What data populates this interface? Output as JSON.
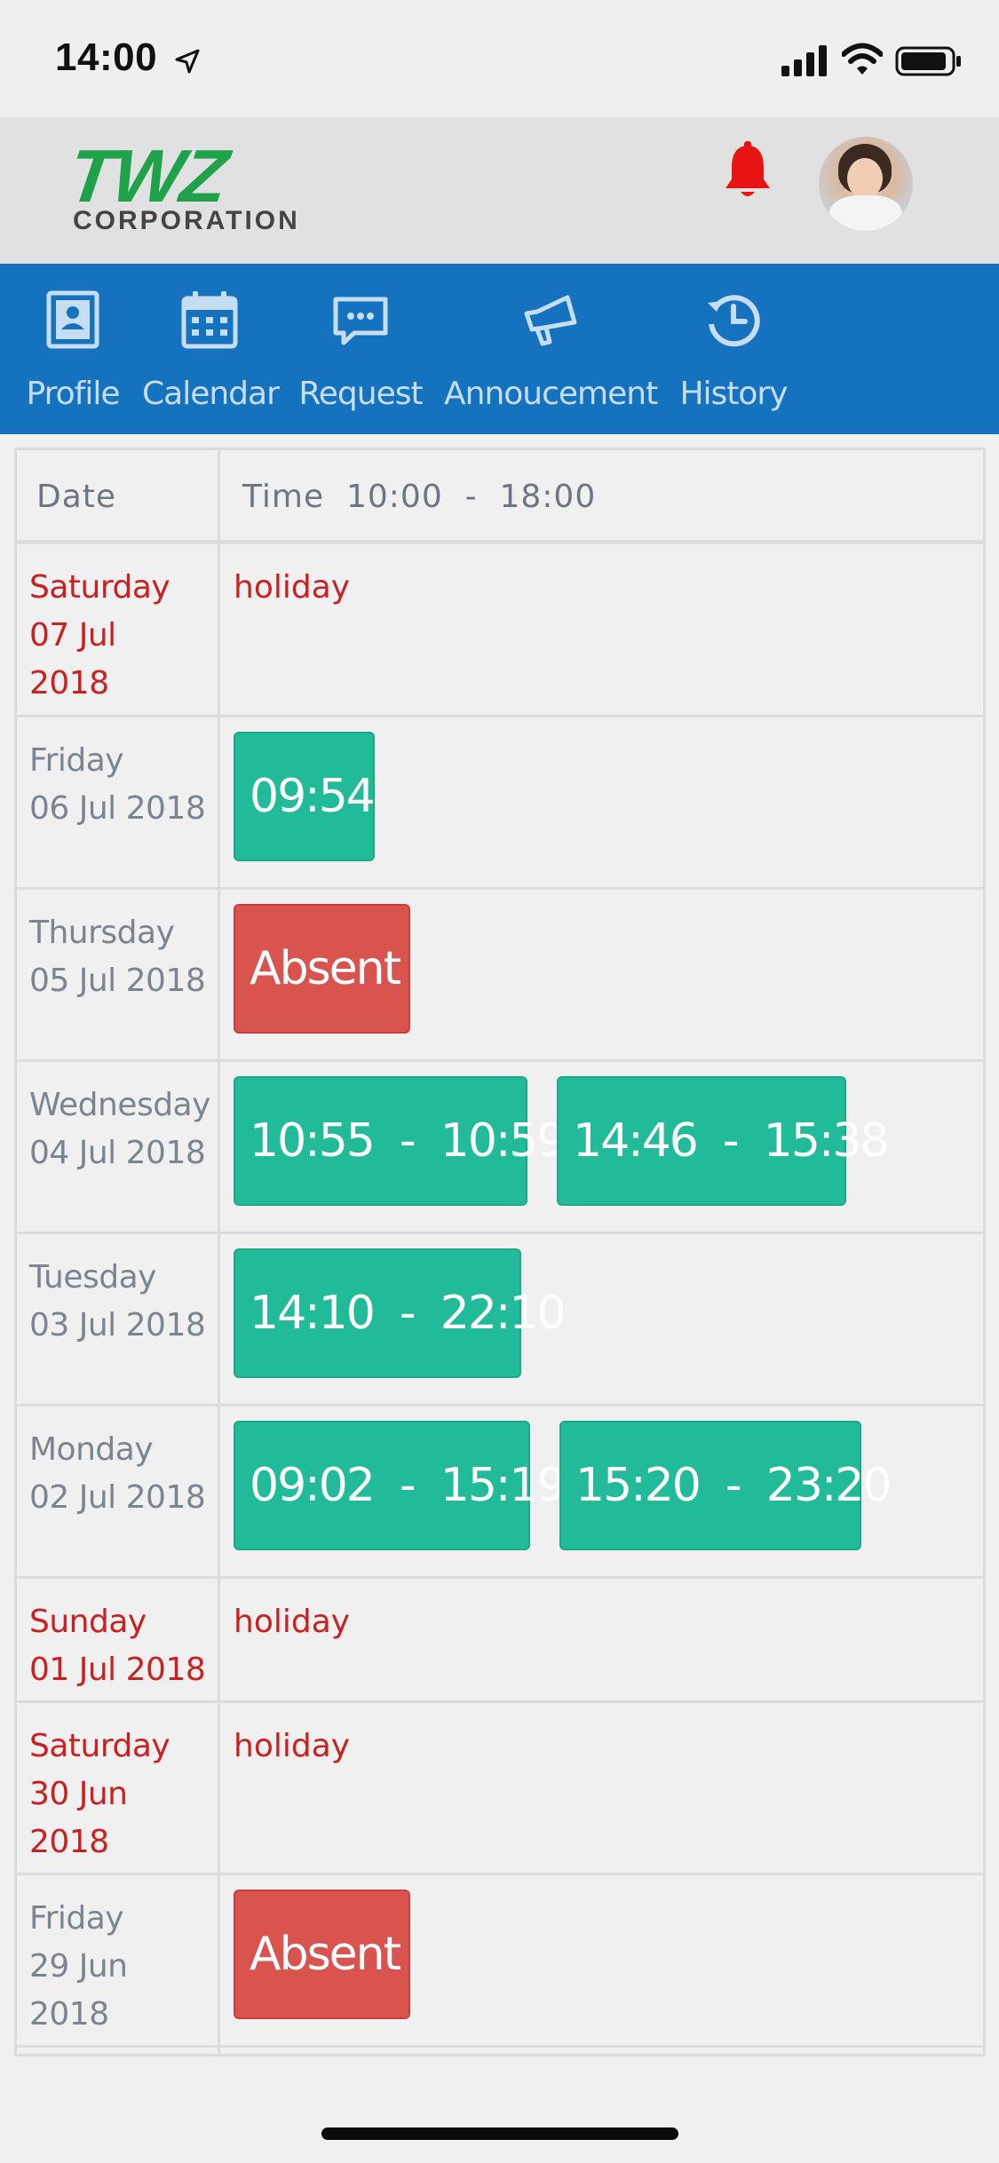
{
  "status_bar": {
    "time": "14:00",
    "icons": [
      "location-arrow-icon",
      "signal-icon",
      "wifi-icon",
      "battery-icon"
    ]
  },
  "header": {
    "logo": {
      "main": "TWZ",
      "sub": "CORPORATION"
    },
    "icons": [
      "bell-icon"
    ],
    "colors": {
      "logo_green": "#1fa24a",
      "bell": "#e81414"
    }
  },
  "nav": {
    "items": [
      {
        "label": "Profile",
        "icon": "profile-card-icon"
      },
      {
        "label": "Calendar",
        "icon": "calendar-icon"
      },
      {
        "label": "Request",
        "icon": "chat-bubble-icon"
      },
      {
        "label": "Annoucement",
        "icon": "megaphone-icon"
      },
      {
        "label": "History",
        "icon": "history-clock-icon"
      }
    ],
    "colors": {
      "background": "#1572be",
      "label": "#c7ddf1"
    }
  },
  "table": {
    "header": {
      "date": "Date",
      "time": "Time  10:00  -  18:00"
    },
    "rows": [
      {
        "day": "Saturday",
        "date": "07  Jul",
        "year": "2018",
        "holiday": "holiday",
        "records": []
      },
      {
        "day": "Friday",
        "date": "06  Jul  2018",
        "records": [
          {
            "text": "09:54",
            "status": "present"
          }
        ]
      },
      {
        "day": "Thursday",
        "date": "05  Jul  2018",
        "records": [
          {
            "text": "Absent",
            "status": "absent"
          }
        ]
      },
      {
        "day": "Wednesday",
        "date": "04  Jul  2018",
        "records": [
          {
            "text": "10:55  -  10:59",
            "status": "present"
          },
          {
            "text": "14:46  -  15:38",
            "status": "present"
          }
        ]
      },
      {
        "day": "Tuesday",
        "date": "03  Jul  2018",
        "records": [
          {
            "text": "14:10  -  22:10",
            "status": "present"
          }
        ]
      },
      {
        "day": "Monday",
        "date": "02  Jul  2018",
        "records": [
          {
            "text": "09:02  -  15:19",
            "status": "present"
          },
          {
            "text": "15:20  -  23:20",
            "status": "present"
          }
        ]
      },
      {
        "day": "Sunday",
        "date": "01  Jul  2018",
        "holiday": "holiday",
        "records": []
      },
      {
        "day": "Saturday",
        "date": "30  Jun",
        "year": "2018",
        "holiday": "holiday",
        "records": []
      },
      {
        "day": "Friday",
        "date": "29  Jun",
        "year": "2018",
        "records": [
          {
            "text": "Absent",
            "status": "absent"
          }
        ]
      }
    ],
    "colors": {
      "present": "#22bb99",
      "absent": "#d9534f",
      "holiday": "#c92121",
      "date_text": "#7a8591"
    }
  }
}
